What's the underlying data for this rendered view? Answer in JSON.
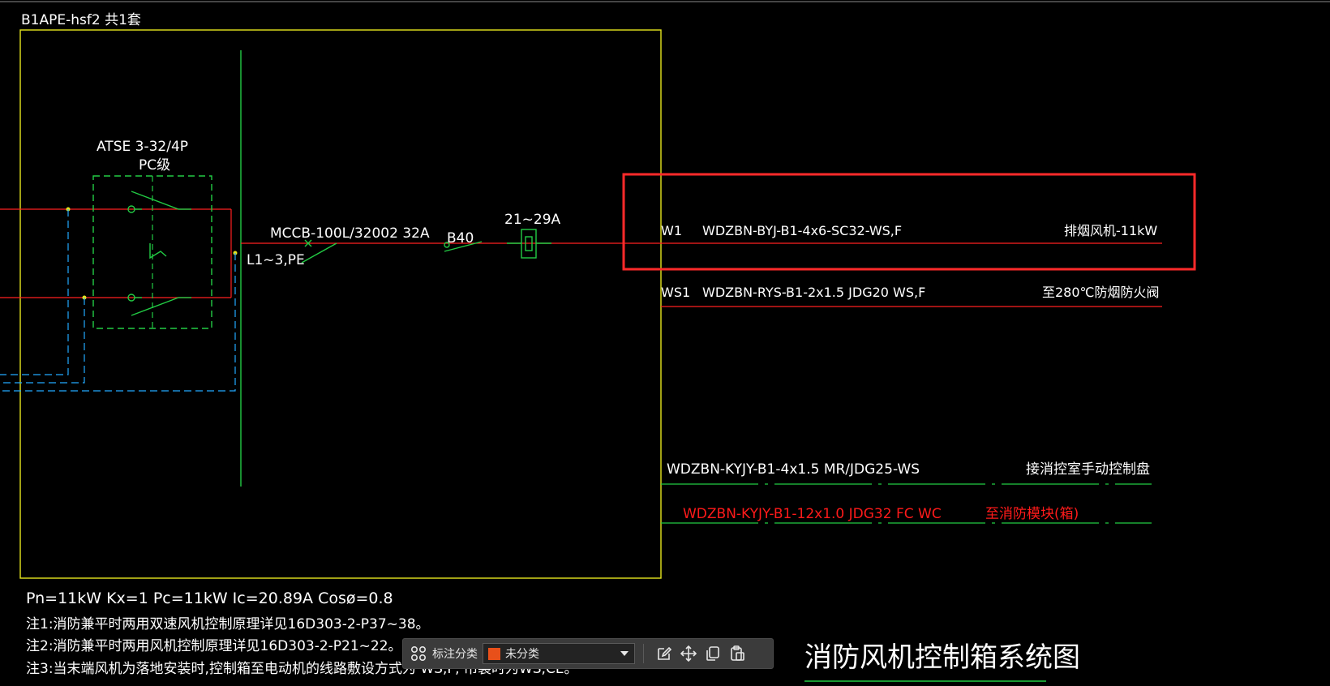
{
  "drawing": {
    "box_title": "B1APE-hsf2   共1套",
    "atse_model": "ATSE 3-32/4P",
    "atse_class": "PC级",
    "mccb_label": "MCCB-100L/32002 32A",
    "phase_label": "L1~3,PE",
    "b40_label": "B40",
    "thermal_label": "21~29A",
    "circuits": [
      {
        "id": "W1",
        "cable": "WDZBN-BYJ-B1-4x6-SC32-WS,F",
        "target": "排烟风机-11kW"
      },
      {
        "id": "WS1",
        "cable": "WDZBN-RYS-B1-2x1.5  JDG20  WS,F",
        "target": "至280℃防烟防火阀"
      }
    ],
    "control_lines": [
      {
        "cable": "WDZBN-KYJY-B1-4x1.5  MR/JDG25-WS",
        "target": "接消控室手动控制盘"
      },
      {
        "cable": "WDZBN-KYJY-B1-12x1.0  JDG32  FC  WC",
        "target": "至消防模块(箱)"
      }
    ],
    "params": "Pn=11kW   Kx=1   Pc=11kW   Ic=20.89A   Cosø=0.8",
    "notes": [
      "注1:消防兼平时两用双速风机控制原理详见16D303-2-P37~38。",
      "注2:消防兼平时两用风机控制原理详见16D303-2-P21~22。",
      "注3:当末端风机为落地安装时,控制箱至电动机的线路敷设方式为 WS,F,   吊装时为WS,CE。"
    ],
    "drawing_title": "消防风机控制箱系统图",
    "colors": {
      "frame": "#e6e61e",
      "green": "#22cc44",
      "red": "#ff2020",
      "cyan": "#22aaff",
      "highlight": "#ff2a2a"
    }
  },
  "toolbar": {
    "grid_icon": "grid-icon",
    "label": "标注分类",
    "select_value": "未分类",
    "swatch_color": "#e8501a",
    "buttons": [
      "edit-icon",
      "move-icon",
      "copy-icon",
      "paste-icon"
    ]
  }
}
